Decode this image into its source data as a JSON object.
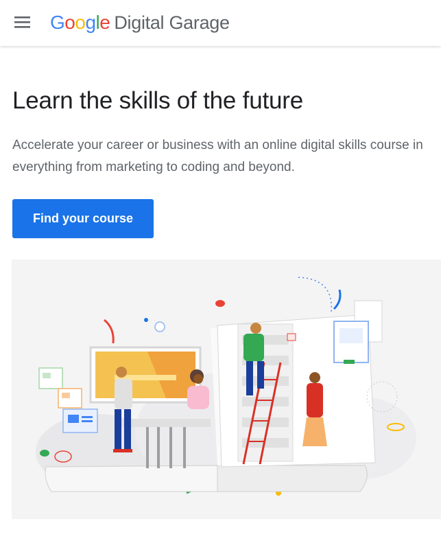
{
  "header": {
    "menu_icon": "hamburger-menu-icon",
    "logo": {
      "google_letters": [
        {
          "char": "G",
          "color": "#4285F4"
        },
        {
          "char": "o",
          "color": "#EA4335"
        },
        {
          "char": "o",
          "color": "#FBBC05"
        },
        {
          "char": "g",
          "color": "#4285F4"
        },
        {
          "char": "l",
          "color": "#34A853"
        },
        {
          "char": "e",
          "color": "#EA4335"
        }
      ],
      "product": "Digital Garage"
    }
  },
  "hero": {
    "title": "Learn the skills of the future",
    "subtitle": "Accelerate your career or business with an online digital skills course in everything from marketing to coding and beyond.",
    "cta_label": "Find your course",
    "illustration": "people-learning-in-open-book-illustration"
  },
  "colors": {
    "primary": "#1a73e8",
    "heading": "#202124",
    "body_text": "#5f6368",
    "google_blue": "#4285F4",
    "google_red": "#EA4335",
    "google_yellow": "#FBBC05",
    "google_green": "#34A853"
  }
}
